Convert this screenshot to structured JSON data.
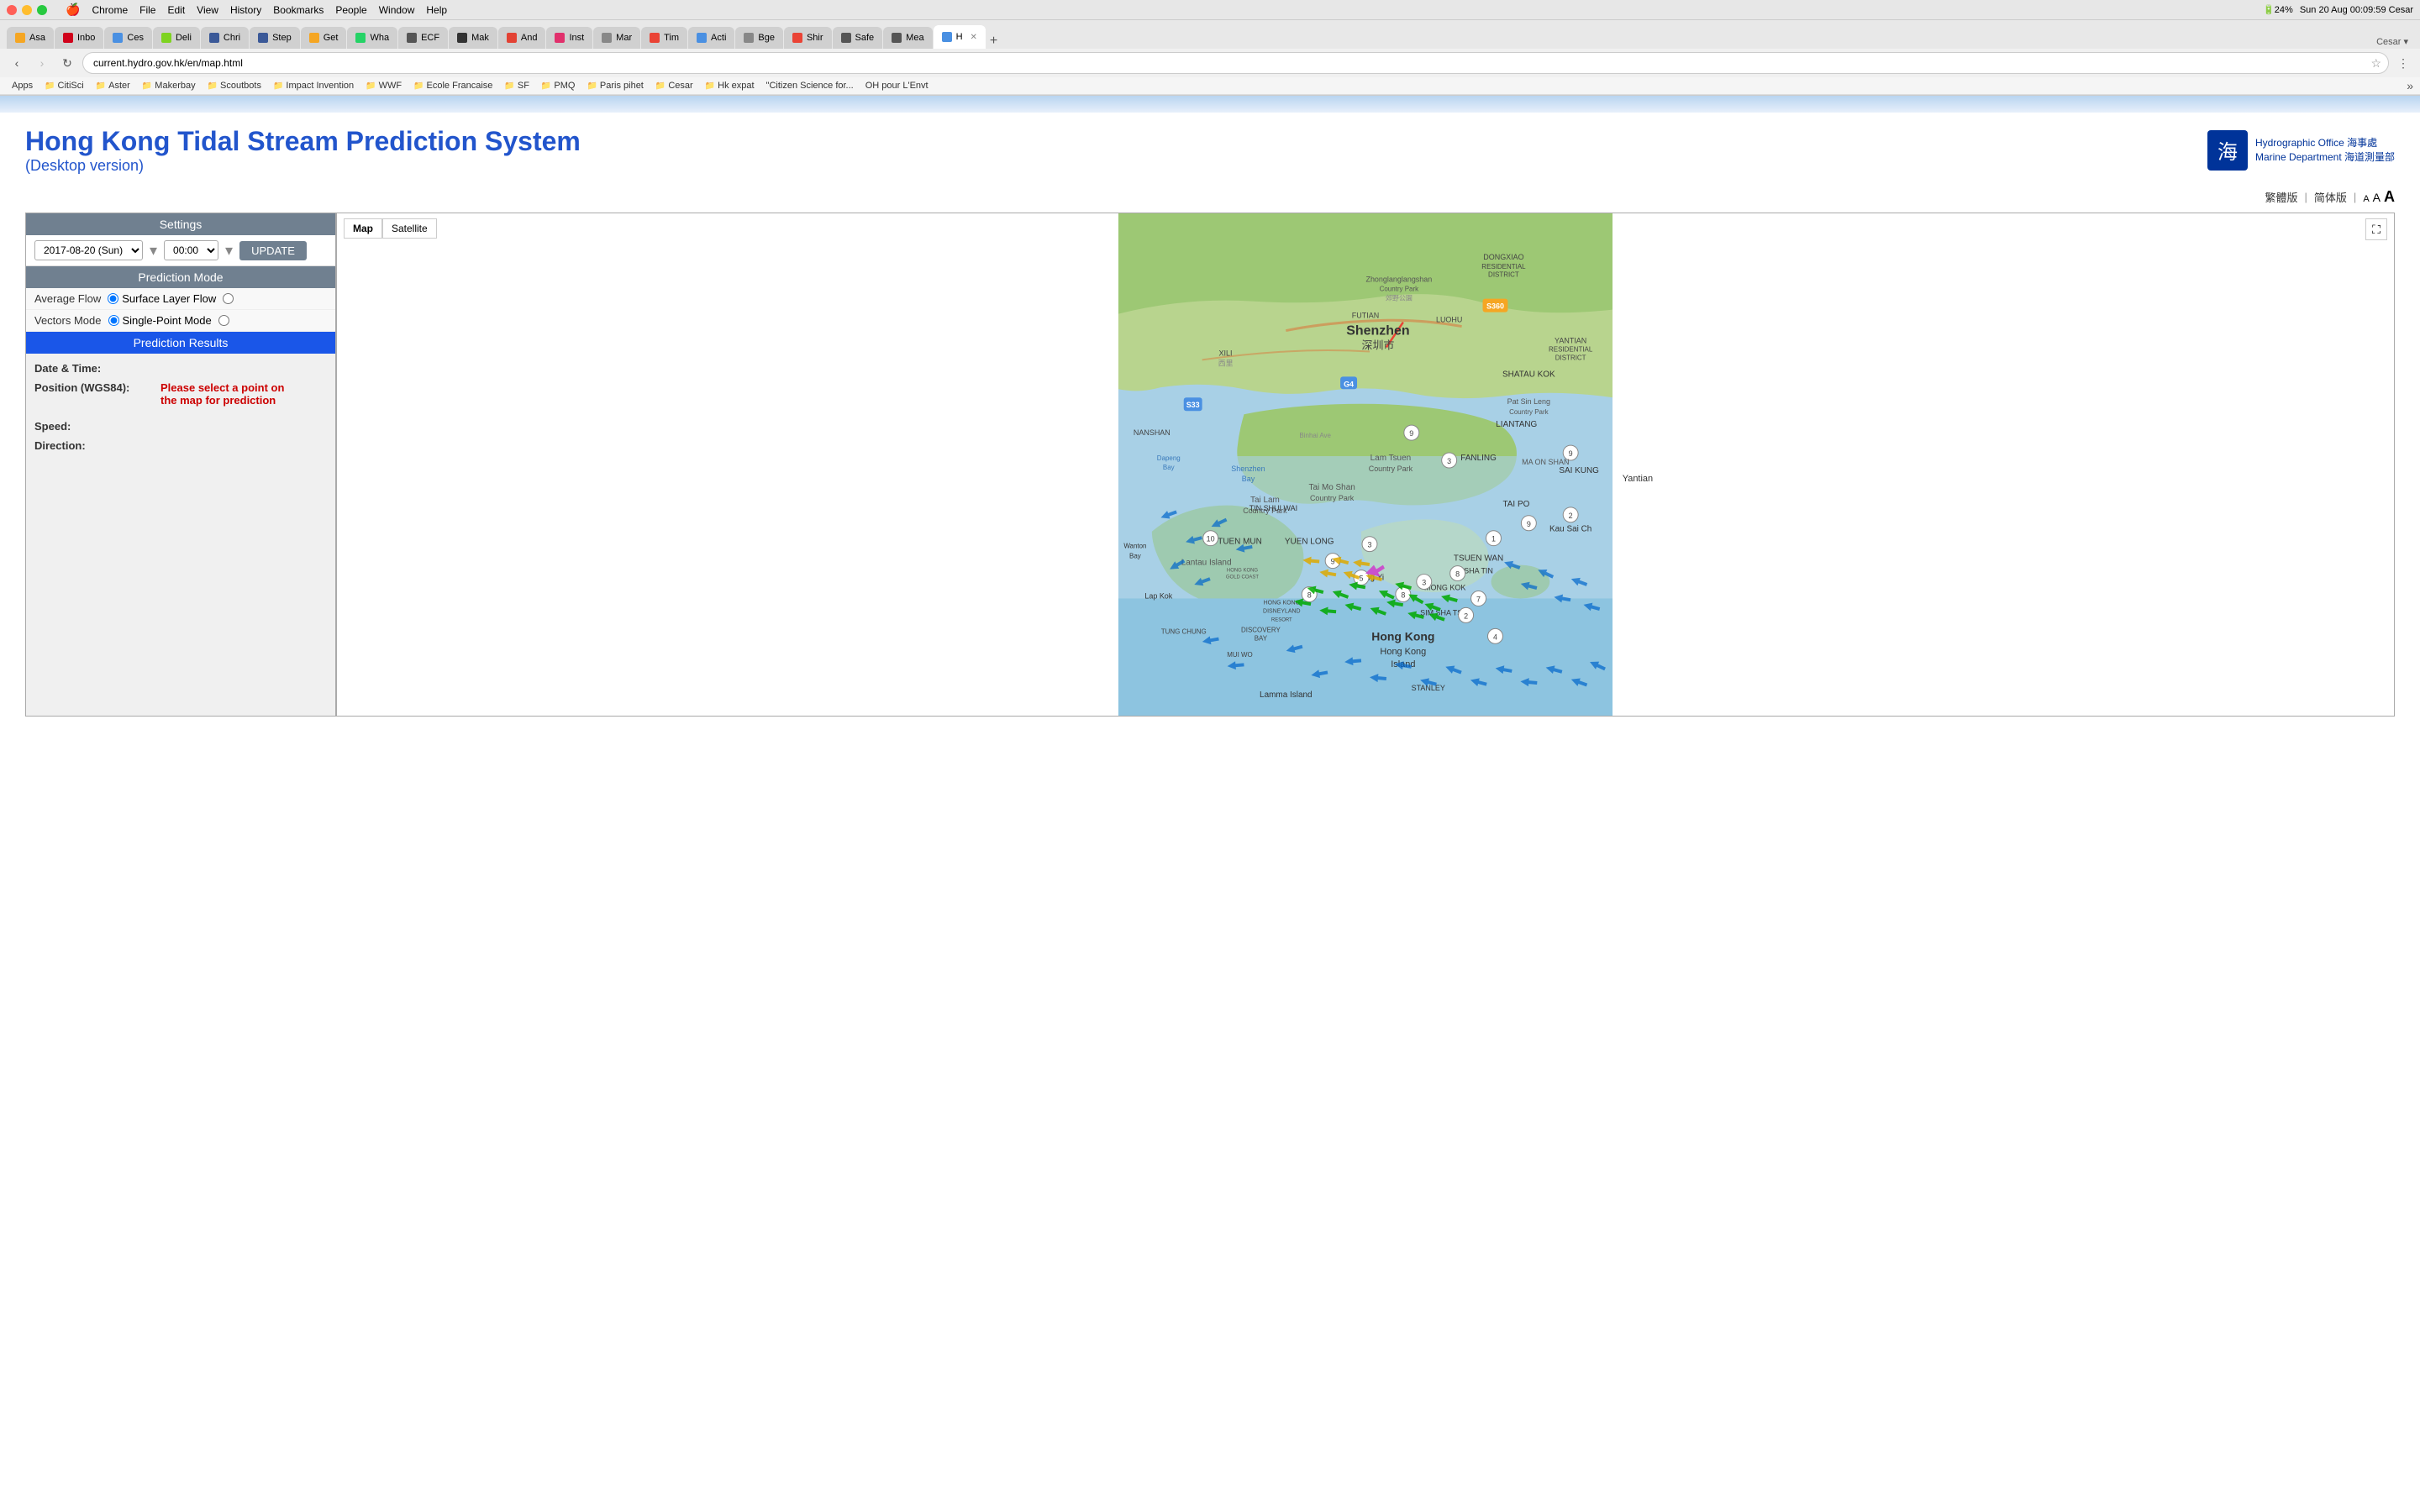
{
  "os": {
    "menubar": {
      "apple": "🍎",
      "items": [
        "Chrome",
        "File",
        "Edit",
        "View",
        "History",
        "Bookmarks",
        "People",
        "Window",
        "Help"
      ],
      "right": "Sun 20 Aug  00:09:59  Cesar"
    }
  },
  "browser": {
    "tabs": [
      {
        "label": "Asa",
        "color": "#f5a623",
        "active": false
      },
      {
        "label": "Inbo",
        "color": "#d0021b",
        "active": false
      },
      {
        "label": "Ces",
        "color": "#4a90e2",
        "active": false
      },
      {
        "label": "Deli",
        "color": "#7ed321",
        "active": false
      },
      {
        "label": "Chri",
        "color": "#3b5998",
        "active": false
      },
      {
        "label": "Step",
        "color": "#3b5998",
        "active": false
      },
      {
        "label": "Get",
        "color": "#f5a623",
        "active": false
      },
      {
        "label": "Wha",
        "color": "#25d366",
        "active": false
      },
      {
        "label": "ECF",
        "color": "#555",
        "active": false
      },
      {
        "label": "Mak",
        "color": "#333",
        "active": false
      },
      {
        "label": "And",
        "color": "#e34234",
        "active": false
      },
      {
        "label": "Inst",
        "color": "#e1306c",
        "active": false
      },
      {
        "label": "Mar",
        "color": "#888",
        "active": false
      },
      {
        "label": "Tim",
        "color": "#ea4335",
        "active": false
      },
      {
        "label": "Acti",
        "color": "#4a90e2",
        "active": false
      },
      {
        "label": "Bge",
        "color": "#888",
        "active": false
      },
      {
        "label": "Shir",
        "color": "#ea4335",
        "active": false
      },
      {
        "label": "Safe",
        "color": "#555",
        "active": false
      },
      {
        "label": "Mea",
        "color": "#555",
        "active": false
      },
      {
        "label": "H x",
        "color": "#4a90e2",
        "active": true
      }
    ],
    "url": "current.hydro.gov.hk/en/map.html",
    "bookmarks": [
      {
        "label": "Apps",
        "folder": false
      },
      {
        "label": "CitiSci",
        "folder": true
      },
      {
        "label": "Aster",
        "folder": true
      },
      {
        "label": "Makerbay",
        "folder": true
      },
      {
        "label": "Scoutbots",
        "folder": true
      },
      {
        "label": "Impact Invention",
        "folder": true
      },
      {
        "label": "WWF",
        "folder": true
      },
      {
        "label": "Ecole Francaise",
        "folder": true
      },
      {
        "label": "SF",
        "folder": true
      },
      {
        "label": "PMQ",
        "folder": true
      },
      {
        "label": "Paris pihet",
        "folder": true
      },
      {
        "label": "Cesar",
        "folder": true
      },
      {
        "label": "Hk expat",
        "folder": true
      },
      {
        "label": "\"Citizen Science for...",
        "folder": false
      },
      {
        "label": "OH pour L'Envt",
        "folder": false
      }
    ]
  },
  "page": {
    "header_bar_color": "#c0d8f0",
    "title": "Hong Kong Tidal Stream Prediction System",
    "subtitle": "(Desktop version)",
    "logo_icon": "海",
    "logo_line1": "Hydrographic Office 海事處",
    "logo_line2": "Marine Department 海道測量部",
    "lang": {
      "traditional": "繁體版",
      "simplified": "简体版",
      "font_small": "A",
      "font_medium": "A",
      "font_large": "A"
    },
    "settings": {
      "header": "Settings",
      "date_value": "2017-08-20 (Sun)",
      "time_value": "00:00",
      "update_btn": "UPDATE",
      "prediction_mode_header": "Prediction Mode",
      "modes": [
        {
          "label": "Average Flow",
          "radio_checked": false,
          "option_label": "Surface Layer Flow",
          "option_checked": true
        },
        {
          "label": "Vectors Mode",
          "radio_checked": false,
          "option_label": "Single-Point Mode",
          "option_checked": true
        }
      ],
      "prediction_results_header": "Prediction Results",
      "results": {
        "datetime_label": "Date & Time:",
        "datetime_value": "",
        "position_label": "Position (WGS84):",
        "position_value": "Please select a point on\nthe map for prediction",
        "speed_label": "Speed:",
        "speed_value": "",
        "direction_label": "Direction:",
        "direction_value": ""
      }
    },
    "map": {
      "map_btn": "Map",
      "satellite_btn": "Satellite",
      "active_btn": "Map",
      "fullscreen_icon": "⛶"
    }
  }
}
